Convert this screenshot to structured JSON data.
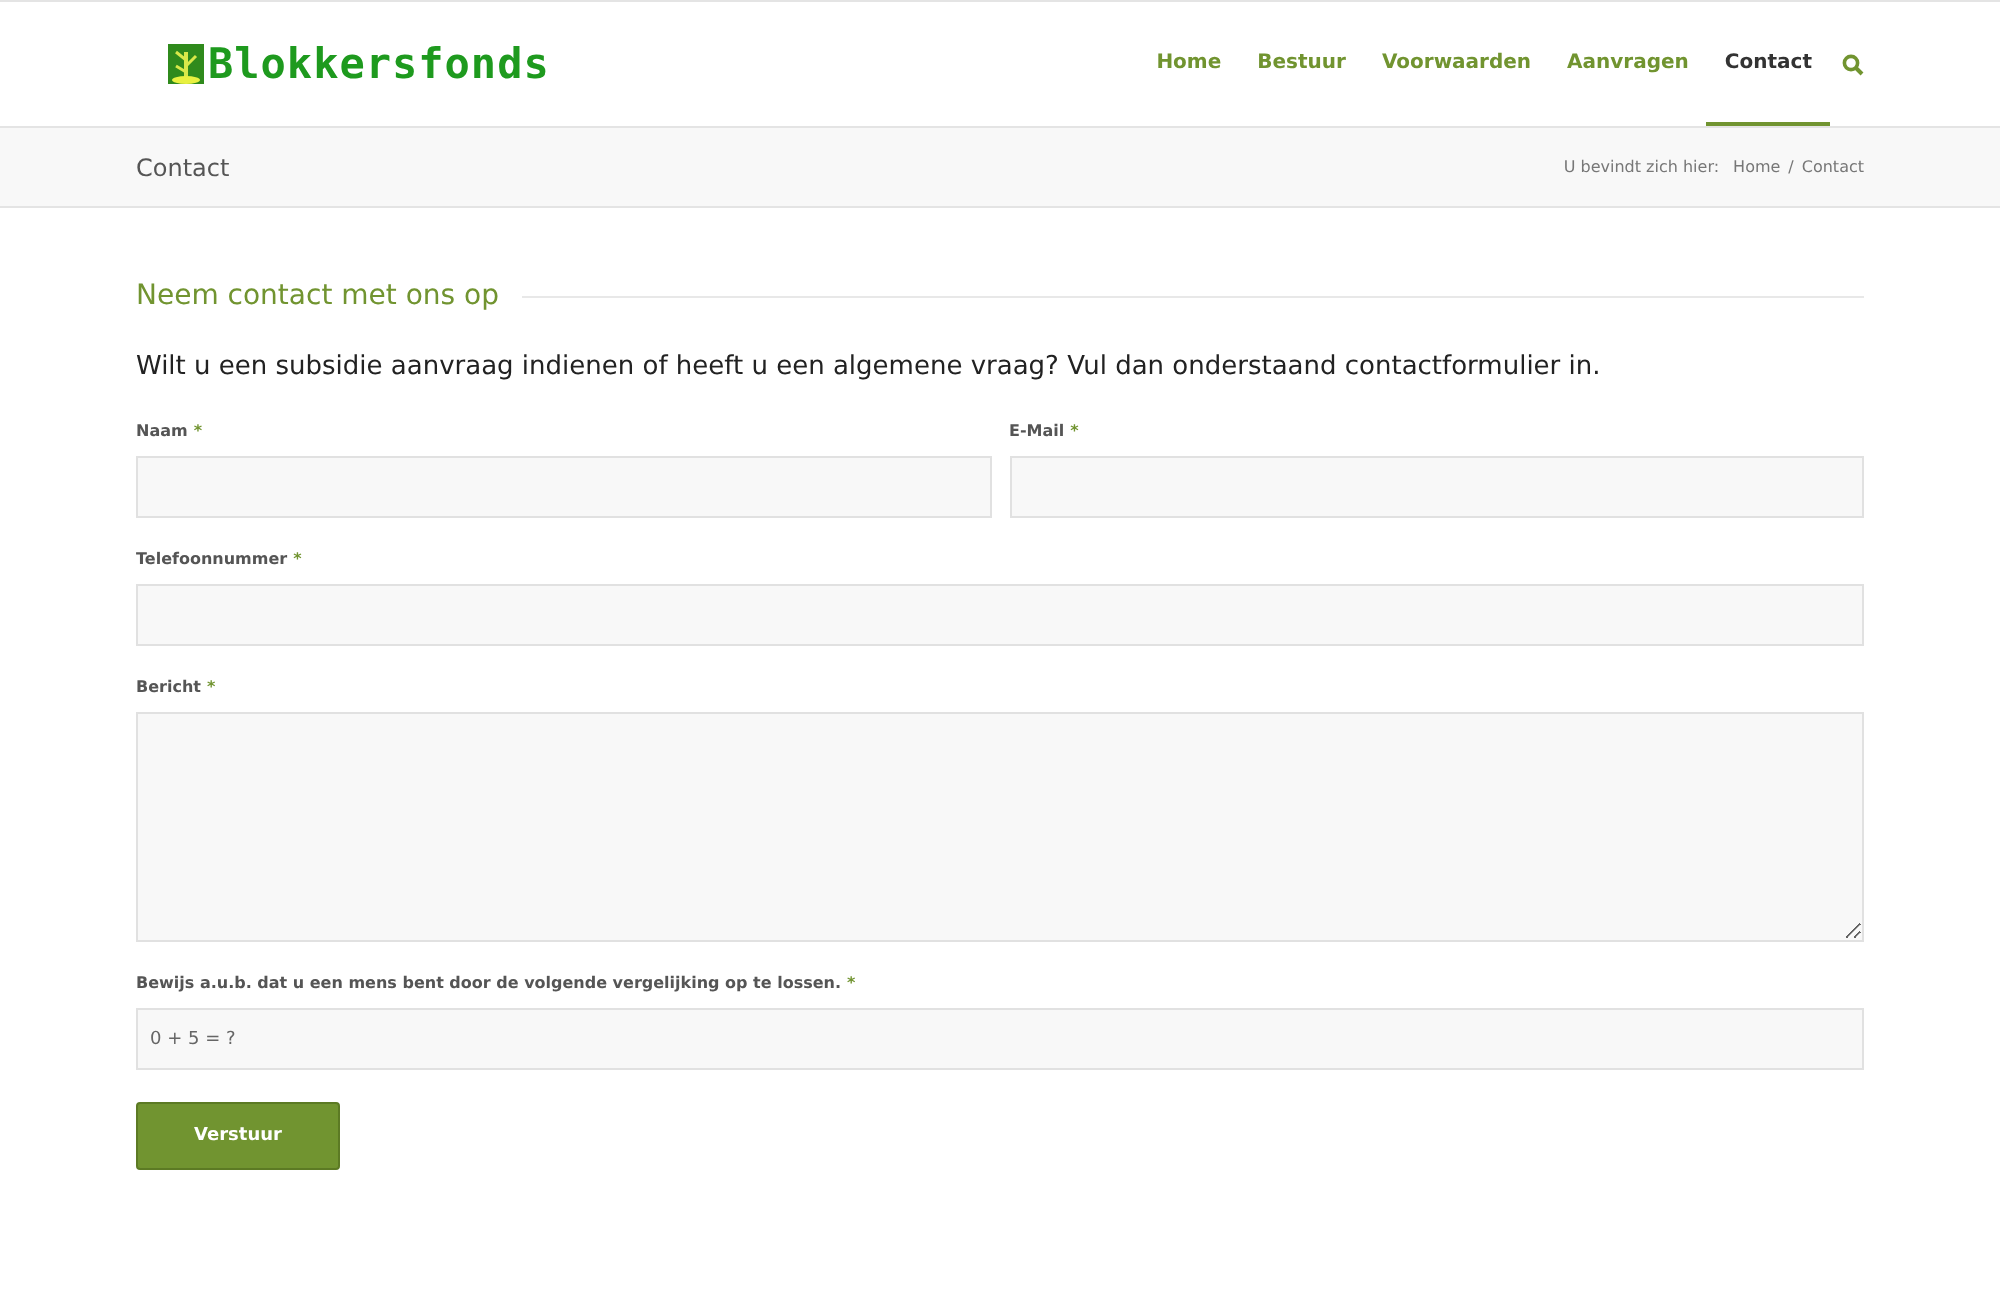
{
  "header": {
    "logo": "Blokkersfonds",
    "nav": [
      {
        "label": "Home",
        "selected": false
      },
      {
        "label": "Bestuur",
        "selected": false
      },
      {
        "label": "Voorwaarden",
        "selected": false
      },
      {
        "label": "Aanvragen",
        "selected": false
      },
      {
        "label": "Contact",
        "selected": true
      }
    ]
  },
  "title_bar": {
    "title": "Contact",
    "breadcrumb_prefix": "U bevindt zich hier:",
    "breadcrumbs": [
      "Home",
      "Contact"
    ],
    "separator": "/"
  },
  "section_heading": "Neem contact met ons op",
  "intro": "Wilt u een subsidie aanvraag indienen of heeft u een algemene vraag? Vul dan onderstaand contactformulier in.",
  "form_rows": [
    [
      {
        "kind": "text",
        "label": "Naam",
        "required": true
      },
      {
        "kind": "text",
        "label": "E-Mail",
        "required": true
      }
    ],
    [
      {
        "kind": "text",
        "label": "Telefoonnummer",
        "required": true
      }
    ],
    [
      {
        "kind": "textarea",
        "label": "Bericht",
        "required": true
      }
    ],
    [
      {
        "kind": "text",
        "label": "Bewijs a.u.b. dat u een mens bent door de volgende vergelijking op te lossen.",
        "required": true,
        "placeholder": "0 + 5 = ?"
      }
    ]
  ],
  "required_mark": "*",
  "submit": "Verstuur"
}
